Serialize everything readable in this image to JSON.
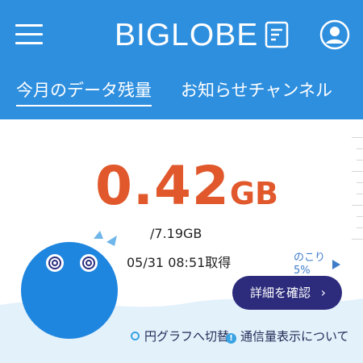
{
  "header": {
    "logo": "BIGLOBE",
    "tabs": [
      {
        "label": "今月のデータ残量",
        "active": true
      },
      {
        "label": "お知らせチャンネル",
        "active": false
      }
    ]
  },
  "usage": {
    "value": "0.42",
    "unit": "GB",
    "total": "/7.19GB",
    "acquired": "05/31 08:51取得",
    "remaining_label": "のこり",
    "remaining_pct": "5%"
  },
  "actions": {
    "detail_button": "詳細を確認",
    "detail_chevron": "›",
    "pie_link": "円グラフへ切替",
    "info_link": "通信量表示について",
    "info_mark": "!"
  },
  "colors": {
    "header_bg": "#2e8fdf",
    "usage_text": "#e0582c",
    "button_bg": "#2c2b7c",
    "mascot": "#1f86e0",
    "wave": "#e3f1fb"
  }
}
